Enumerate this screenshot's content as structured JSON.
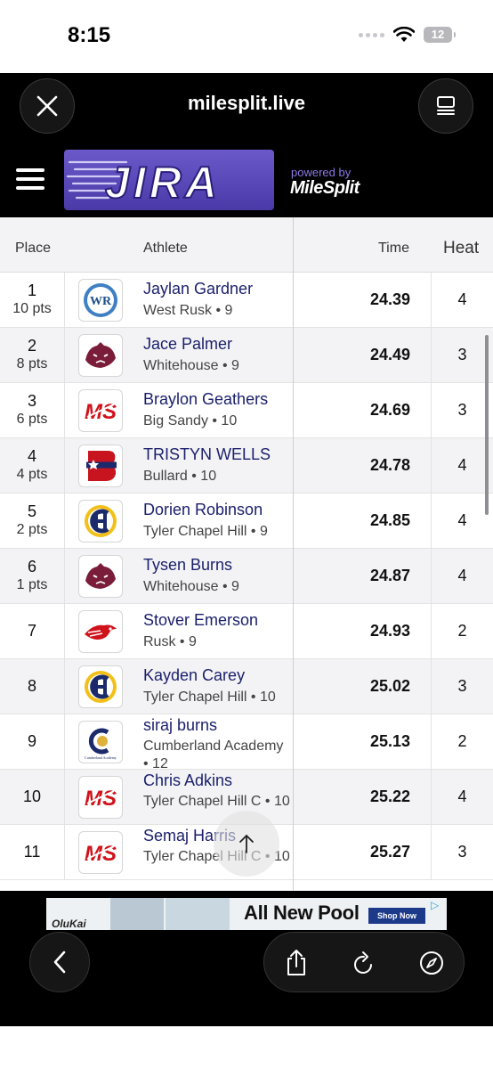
{
  "status_bar": {
    "time": "8:15",
    "battery": "12"
  },
  "browser": {
    "url": "milesplit.live"
  },
  "site": {
    "logo_text": "JIRA",
    "powered_by": "powered by",
    "brand": "MileSplit"
  },
  "table": {
    "headers": {
      "place": "Place",
      "athlete": "Athlete",
      "time": "Time",
      "heat": "Heat"
    },
    "rows": [
      {
        "place": "1",
        "points": "10 pts",
        "name": "Jaylan Gardner",
        "team_line": "West Rusk • 9",
        "time": "24.39",
        "heat": "4",
        "logo": "west-rusk-logo"
      },
      {
        "place": "2",
        "points": "8 pts",
        "name": "Jace Palmer",
        "team_line": "Whitehouse • 9",
        "time": "24.49",
        "heat": "3",
        "logo": "whitehouse-wildcat-logo"
      },
      {
        "place": "3",
        "points": "6 pts",
        "name": "Braylon Geathers",
        "team_line": "Big Sandy • 10",
        "time": "24.69",
        "heat": "3",
        "logo": "milesplit-ms-logo"
      },
      {
        "place": "4",
        "points": "4 pts",
        "name": "TRISTYN WELLS",
        "team_line": "Bullard • 10",
        "time": "24.78",
        "heat": "4",
        "logo": "bullard-b-logo"
      },
      {
        "place": "5",
        "points": "2 pts",
        "name": "Dorien Robinson",
        "team_line": "Tyler Chapel Hill • 9",
        "time": "24.85",
        "heat": "4",
        "logo": "chapel-hill-ch-logo"
      },
      {
        "place": "6",
        "points": "1 pts",
        "name": "Tysen Burns",
        "team_line": "Whitehouse • 9",
        "time": "24.87",
        "heat": "4",
        "logo": "whitehouse-wildcat-logo"
      },
      {
        "place": "7",
        "points": "",
        "name": "Stover Emerson",
        "team_line": "Rusk • 9",
        "time": "24.93",
        "heat": "2",
        "logo": "rusk-eagle-logo"
      },
      {
        "place": "8",
        "points": "",
        "name": "Kayden Carey",
        "team_line": "Tyler Chapel Hill • 10",
        "time": "25.02",
        "heat": "3",
        "logo": "chapel-hill-ch-logo"
      },
      {
        "place": "9",
        "points": "",
        "name": "siraj burns",
        "team_line": "Cumberland Academy • 12",
        "time": "25.13",
        "heat": "2",
        "logo": "cumberland-academy-logo"
      },
      {
        "place": "10",
        "points": "",
        "name": "Chris Adkins",
        "team_line": "Tyler Chapel Hill C • 10",
        "time": "25.22",
        "heat": "4",
        "logo": "milesplit-ms-logo"
      },
      {
        "place": "11",
        "points": "",
        "name": "Semaj Harris",
        "team_line": "Tyler Chapel Hill C • 10",
        "time": "25.27",
        "heat": "3",
        "logo": "milesplit-ms-logo"
      }
    ]
  },
  "ad": {
    "text": "All New Pool",
    "shop": "Shop Now",
    "brand": "OluKai"
  },
  "colors": {
    "athlete_name": "#1a1f6b",
    "logo_purple": "#4a3aa8",
    "milesplit_red": "#d0121b"
  }
}
